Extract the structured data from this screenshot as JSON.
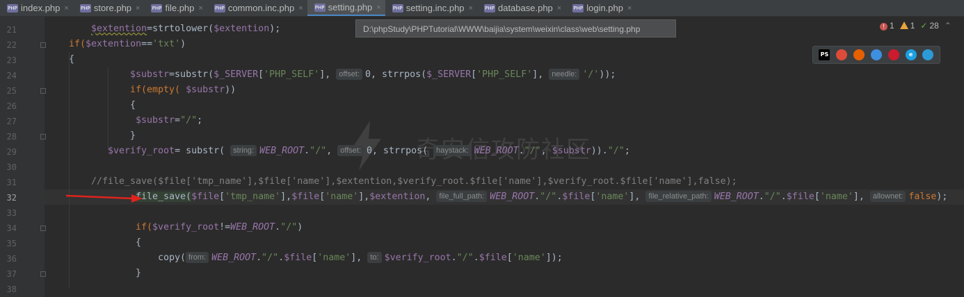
{
  "tabs": [
    {
      "label": "index.php",
      "active": false
    },
    {
      "label": "store.php",
      "active": false
    },
    {
      "label": "file.php",
      "active": false
    },
    {
      "label": "common.inc.php",
      "active": false
    },
    {
      "label": "setting.php",
      "active": true
    },
    {
      "label": "setting.inc.php",
      "active": false
    },
    {
      "label": "database.php",
      "active": false
    },
    {
      "label": "login.php",
      "active": false
    }
  ],
  "tab_icon_text": "PHP",
  "tab_close_glyph": "×",
  "tooltip_path": "D:\\phpStudy\\PHPTutorial\\WWW\\baijia\\system\\weixin\\class\\web\\setting.php",
  "inspections": {
    "errors": "1",
    "warnings": "1",
    "ok": "28"
  },
  "browsers": [
    {
      "name": "phpstorm-icon",
      "label": "PS",
      "color": "#000000"
    },
    {
      "name": "chrome-icon",
      "label": "",
      "color": "#dd4b39"
    },
    {
      "name": "firefox-icon",
      "label": "",
      "color": "#e66000"
    },
    {
      "name": "safari-icon",
      "label": "",
      "color": "#3d8fe0"
    },
    {
      "name": "opera-icon",
      "label": "",
      "color": "#cc1b2e"
    },
    {
      "name": "ie-icon",
      "label": "e",
      "color": "#1ba1e2"
    },
    {
      "name": "edge-icon",
      "label": "",
      "color": "#2d9ad8"
    }
  ],
  "watermark": "奇安信攻防社区",
  "line_numbers": [
    "21",
    "22",
    "23",
    "24",
    "25",
    "26",
    "27",
    "28",
    "29",
    "30",
    "31",
    "32",
    "33",
    "34",
    "35",
    "36",
    "37",
    "38"
  ],
  "current_line": "32",
  "code": {
    "l21": {
      "var": "$extention",
      "eq": "=strtolower(",
      "arg": "$extention",
      "end": ");"
    },
    "l22": {
      "kw": "if(",
      "var": "$extention",
      "op": "==",
      "str": "'txt'",
      "end": ")"
    },
    "l23": {
      "t": "{"
    },
    "l24": {
      "var": "$substr",
      "p1": "=substr(",
      "v2": "$_SERVER",
      "p2": "[",
      "s1": "'PHP_SELF'",
      "p3": "],",
      "h1": "offset:",
      "n1": "0",
      "p4": ", strrpos(",
      "v3": "$_SERVER",
      "p5": "[",
      "s2": "'PHP_SELF'",
      "p6": "],",
      "h2": "needle:",
      "s3": "'/'",
      "p7": "));"
    },
    "l25": {
      "kw": "if(",
      "fn": "empty(",
      "var": "$substr",
      "end": "))"
    },
    "l26": {
      "t": "{"
    },
    "l27": {
      "var": "$substr",
      "op": "=",
      "str": "\"/\"",
      "end": ";"
    },
    "l28": {
      "t": "}"
    },
    "l29": {
      "var": "$verify_root",
      "p1": "= substr(",
      "h1": "string:",
      "c1": "WEB_ROOT",
      "p2": ".",
      "s1": "\"/\"",
      "p3": ",",
      "h2": "offset:",
      "n1": "0",
      "p4": ", strrpos(",
      "h3": "haystack:",
      "c2": "WEB_ROOT",
      "p5": ".",
      "s2": "\"/\"",
      "p6": ",",
      "v2": "$substr",
      "p7": ")).",
      "s3": "\"/\"",
      "p8": ";"
    },
    "l31": {
      "t": "//file_save($file['tmp_name'],$file['name'],$extention,$verify_root.$file['name'],$verify_root.$file['name'],false);"
    },
    "l32": {
      "fn": "file_save(",
      "v1": "$file",
      "p1": "[",
      "s1": "'tmp_name'",
      "p2": "],",
      "v2": "$file",
      "p3": "[",
      "s2": "'name'",
      "p4": "],",
      "v3": "$extention",
      "p5": ",",
      "h1": "file_full_path:",
      "c1": "WEB_ROOT",
      "p6": ".",
      "s3": "\"/\"",
      "p7": ".",
      "v4": "$file",
      "p8": "[",
      "s4": "'name'",
      "p9": "],",
      "h2": "file_relative_path:",
      "c2": "WEB_ROOT",
      "p10": ".",
      "s5": "\"/\"",
      "p11": ".",
      "v5": "$file",
      "p12": "[",
      "s6": "'name'",
      "p13": "],",
      "h3": "allownet:",
      "k1": "false",
      "p14": ");"
    },
    "l34": {
      "kw": "if(",
      "var": "$verify_root",
      "op": "!=",
      "c1": "WEB_ROOT",
      "p1": ".",
      "s1": "\"/\"",
      "end": ")"
    },
    "l35": {
      "t": "{"
    },
    "l36": {
      "fn": "copy(",
      "h1": "from:",
      "c1": "WEB_ROOT",
      "p1": ".",
      "s1": "\"/\"",
      "p2": ".",
      "v1": "$file",
      "p3": "[",
      "s2": "'name'",
      "p4": "],",
      "h2": "to:",
      "v2": "$verify_root",
      "p5": ".",
      "s3": "\"/\"",
      "p6": ".",
      "v3": "$file",
      "p7": "[",
      "s4": "'name'",
      "p8": "]);"
    },
    "l37": {
      "t": "}"
    }
  }
}
